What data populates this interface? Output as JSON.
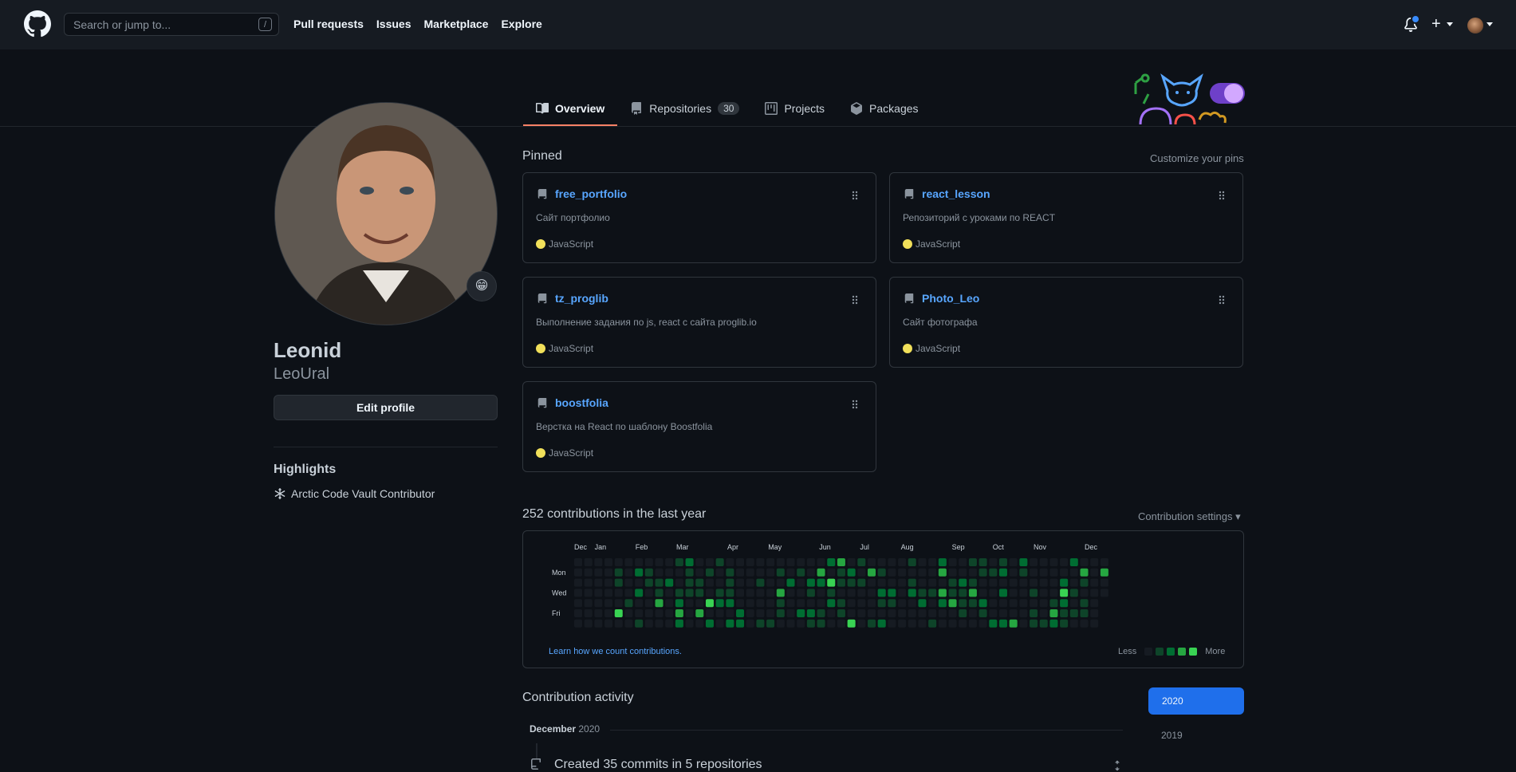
{
  "header": {
    "search_placeholder": "Search or jump to...",
    "search_shortcut": "/",
    "nav": [
      "Pull requests",
      "Issues",
      "Marketplace",
      "Explore"
    ],
    "plus_label": "+"
  },
  "tabs": [
    {
      "label": "Overview",
      "selected": true,
      "icon": "book-icon"
    },
    {
      "label": "Repositories",
      "counter": "30",
      "icon": "repo-icon"
    },
    {
      "label": "Projects",
      "icon": "project-icon"
    },
    {
      "label": "Packages",
      "icon": "package-icon"
    }
  ],
  "profile": {
    "fullname": "Leonid",
    "username": "LeoUral",
    "status_emoji": "😁",
    "edit_button": "Edit profile",
    "highlights_title": "Highlights",
    "highlight_item": "Arctic Code Vault Contributor"
  },
  "pinned": {
    "title": "Pinned",
    "customize": "Customize your pins",
    "repos": [
      {
        "name": "free_portfolio",
        "desc": "Сайт портфолио",
        "lang": "JavaScript"
      },
      {
        "name": "react_lesson",
        "desc": "Репозиторий с уроками по REACT",
        "lang": "JavaScript"
      },
      {
        "name": "tz_proglib",
        "desc": "Выполнение задания по js, react с сайта proglib.io",
        "lang": "JavaScript"
      },
      {
        "name": "Photo_Leo",
        "desc": "Сайт фотографа",
        "lang": "JavaScript"
      },
      {
        "name": "boostfolia",
        "desc": "Верстка на React по шаблону Boostfolia",
        "lang": "JavaScript"
      }
    ],
    "lang_color": "#f1e05a"
  },
  "contributions": {
    "title": "252 contributions in the last year",
    "settings": "Contribution settings",
    "months": [
      "Dec",
      "Jan",
      "Feb",
      "Mar",
      "Apr",
      "May",
      "Jun",
      "Jul",
      "Aug",
      "Sep",
      "Oct",
      "Nov",
      "Dec"
    ],
    "days": [
      "Mon",
      "Wed",
      "Fri"
    ],
    "learn_link": "Learn how we count contributions.",
    "legend_less": "Less",
    "legend_more": "More",
    "colors": [
      "#161b22",
      "#0e4429",
      "#006d32",
      "#26a641",
      "#39d353"
    ]
  },
  "activity": {
    "title": "Contribution activity",
    "years": [
      "2020",
      "2019"
    ],
    "month_bold": "December",
    "month_year": "2020",
    "commits_text": "Created 35 commits in 5 repositories"
  }
}
